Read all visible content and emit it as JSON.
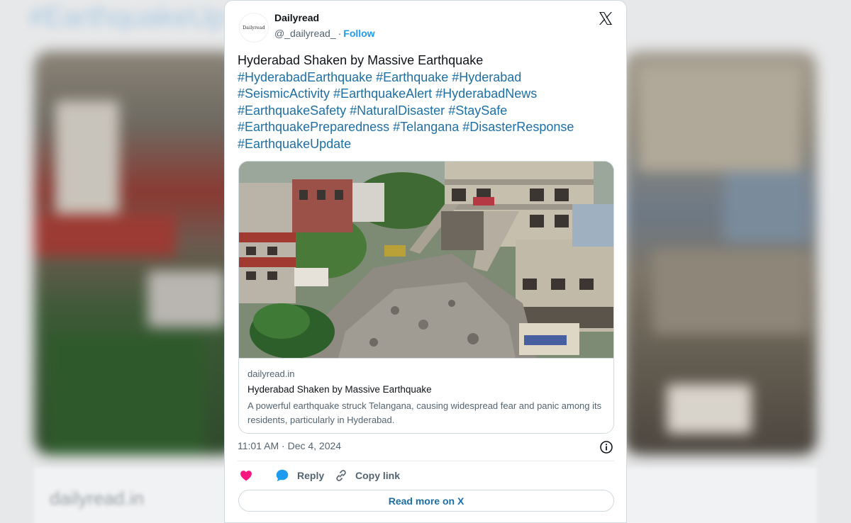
{
  "background": {
    "tag_text": "#EarthquakeUp",
    "footer_text": "dailyread.in"
  },
  "tweet": {
    "author": {
      "display_name": "Dailyread",
      "handle": "@_dailyread_",
      "separator": "·",
      "follow_label": "Follow",
      "avatar_text": "Dailyread"
    },
    "title_line": "Hyderabad Shaken by Massive Earthquake",
    "hashtags": [
      "#HyderabadEarthquake",
      "#Earthquake",
      "#Hyderabad",
      "#SeismicActivity",
      "#EarthquakeAlert",
      "#HyderabadNews",
      "#EarthquakeSafety",
      "#NaturalDisaster",
      "#StaySafe",
      "#EarthquakePreparedness",
      "#Telangana",
      "#DisasterResponse",
      "#EarthquakeUpdate"
    ],
    "link_card": {
      "domain": "dailyread.in",
      "title": "Hyderabad Shaken by Massive Earthquake",
      "description": "A powerful earthquake struck Telangana, causing widespread fear and panic among its residents, particularly in Hyderabad.",
      "image_description_icon": "photo-icon"
    },
    "timestamp": {
      "time": "11:01 AM",
      "separator": "·",
      "date": "Dec 4, 2024"
    },
    "actions": {
      "like_icon": "heart-icon",
      "reply_label": "Reply",
      "copy_label": "Copy link"
    },
    "read_more_label": "Read more on X"
  },
  "colors": {
    "link_blue": "#1d6fa5",
    "follow_blue": "#1d9bf0",
    "heart": "#f91880",
    "reply_bubble": "#1d9bf0"
  }
}
